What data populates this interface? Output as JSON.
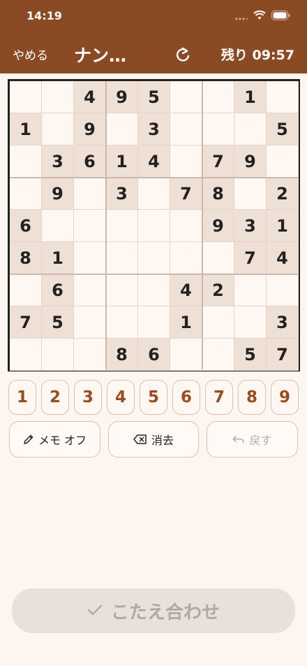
{
  "status": {
    "time": "14:19"
  },
  "header": {
    "quit_label": "やめる",
    "title": "ナン…",
    "reload_icon": "reload-icon",
    "timer": "残り 09:57"
  },
  "board": {
    "rows": [
      [
        "",
        "",
        "4",
        "9",
        "5",
        "",
        "",
        "1",
        ""
      ],
      [
        "1",
        "",
        "9",
        "",
        "3",
        "",
        "",
        "",
        "5"
      ],
      [
        "",
        "3",
        "6",
        "1",
        "4",
        "",
        "7",
        "9",
        ""
      ],
      [
        "",
        "9",
        "",
        "3",
        "",
        "7",
        "8",
        "",
        "2"
      ],
      [
        "6",
        "",
        "",
        "",
        "",
        "",
        "9",
        "3",
        "1"
      ],
      [
        "8",
        "1",
        "",
        "",
        "",
        "",
        "",
        "7",
        "4"
      ],
      [
        "",
        "6",
        "",
        "",
        "",
        "4",
        "2",
        "",
        ""
      ],
      [
        "7",
        "5",
        "",
        "",
        "",
        "1",
        "",
        "",
        "3"
      ],
      [
        "",
        "",
        "",
        "8",
        "6",
        "",
        "",
        "5",
        "7"
      ]
    ]
  },
  "numpad": {
    "keys": [
      "1",
      "2",
      "3",
      "4",
      "5",
      "6",
      "7",
      "8",
      "9"
    ]
  },
  "actions": {
    "memo_label": "メモ オフ",
    "erase_label": "消去",
    "undo_label": "戻す"
  },
  "submit": {
    "label": "こたえ合わせ"
  },
  "colors": {
    "header": "#8a4a24",
    "given_cell": "#efe0d6",
    "number_key": "#9a4c1e"
  }
}
